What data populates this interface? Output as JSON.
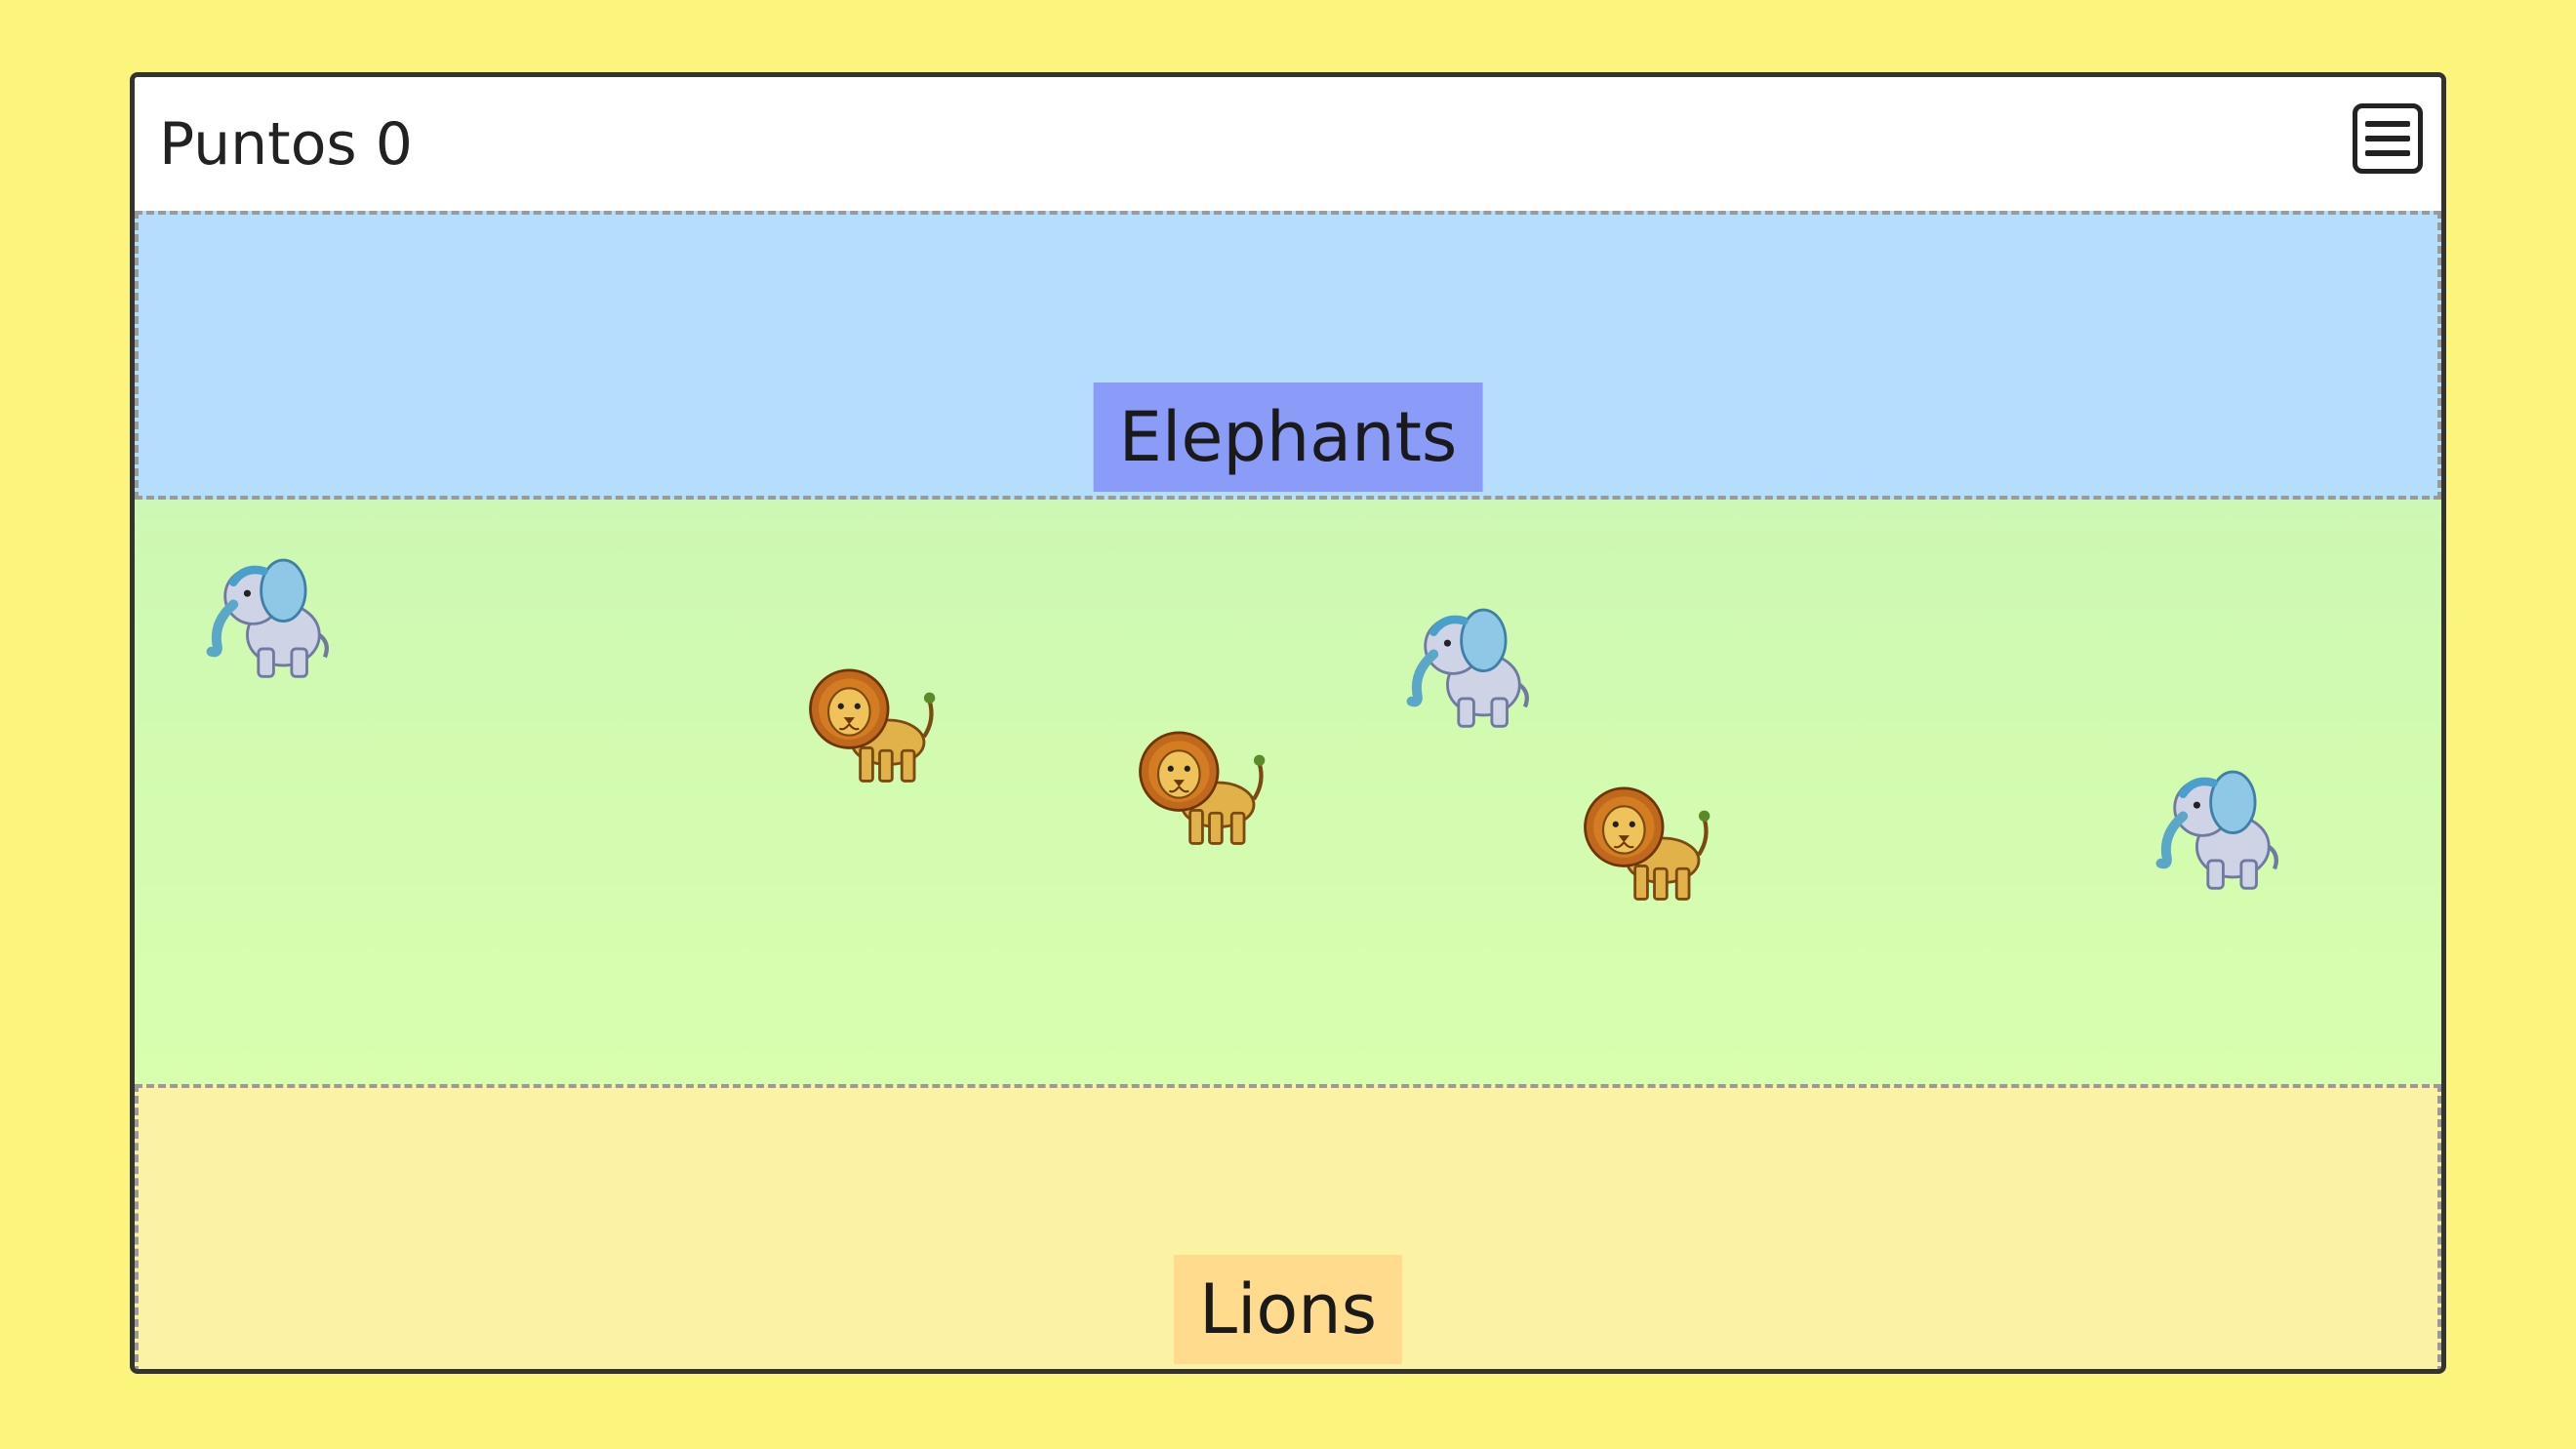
{
  "header": {
    "score_label": "Puntos",
    "score_value": "0"
  },
  "zones": {
    "elephants": {
      "label": "Elephants",
      "color": "#b5defd",
      "label_color": "#8a9cf8"
    },
    "lions": {
      "label": "Lions",
      "color": "#fcf2a4",
      "label_color": "#ffdb8e"
    }
  },
  "field": {
    "color": "#d3fbb0",
    "animals": [
      {
        "type": "elephant",
        "icon": "elephant-icon"
      },
      {
        "type": "lion",
        "icon": "lion-icon"
      },
      {
        "type": "lion",
        "icon": "lion-icon"
      },
      {
        "type": "elephant",
        "icon": "elephant-icon"
      },
      {
        "type": "lion",
        "icon": "lion-icon"
      },
      {
        "type": "elephant",
        "icon": "elephant-icon"
      }
    ]
  },
  "colors": {
    "background": "#fbf57e",
    "window_border": "#333333"
  }
}
